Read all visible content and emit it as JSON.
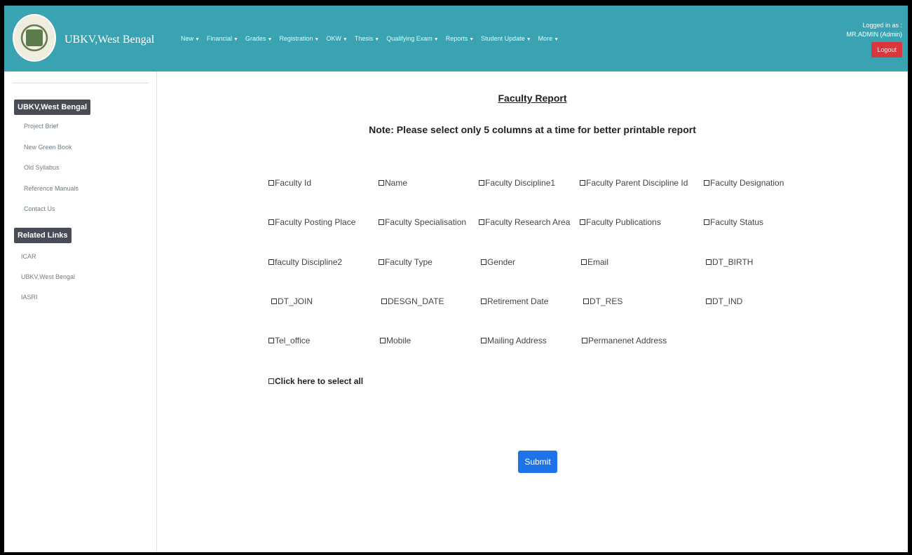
{
  "header": {
    "brand": "UBKV,West Bengal",
    "nav": [
      {
        "label": "New"
      },
      {
        "label": "Financial"
      },
      {
        "label": "Grades"
      },
      {
        "label": "Registration"
      },
      {
        "label": "OKW"
      },
      {
        "label": "Thesis"
      },
      {
        "label": "Qualifying Exam"
      },
      {
        "label": "Reports"
      },
      {
        "label": "Student Update"
      },
      {
        "label": "More"
      }
    ],
    "caret": "▼",
    "logged_in_label": "Logged in as :",
    "user": "MR.ADMIN (Admin)",
    "logout": "Logout"
  },
  "sidebar": {
    "section1": "UBKV,West Bengal",
    "links1": [
      "Project Brief",
      "New Green Book",
      "Old Syllabus",
      "Reference Manuals",
      "Contact Us"
    ],
    "section2": "Related Links",
    "links2": [
      "ICAR",
      "UBKV,West Bengal",
      "IASRI"
    ]
  },
  "main": {
    "title": "Faculty Report",
    "note": "Note: Please select only 5 columns at a time for better printable report",
    "options": [
      [
        "Faculty Id",
        "Name",
        "Faculty Discipline1",
        "Faculty Parent Discipline Id",
        "Faculty Designation"
      ],
      [
        "Faculty Posting Place",
        "Faculty Specialisation",
        "Faculty Research Area",
        "Faculty Publications",
        "Faculty Status"
      ],
      [
        "faculty Discipline2",
        "Faculty Type",
        "Gender",
        "Email",
        "DT_BIRTH"
      ],
      [
        "DT_JOIN",
        "DESGN_DATE",
        "Retirement Date",
        "DT_RES",
        "DT_IND"
      ],
      [
        "Tel_office",
        "Mobile",
        "Mailing Address",
        "Permanenet Address"
      ]
    ],
    "select_all": "Click here to select all",
    "submit": "Submit"
  }
}
